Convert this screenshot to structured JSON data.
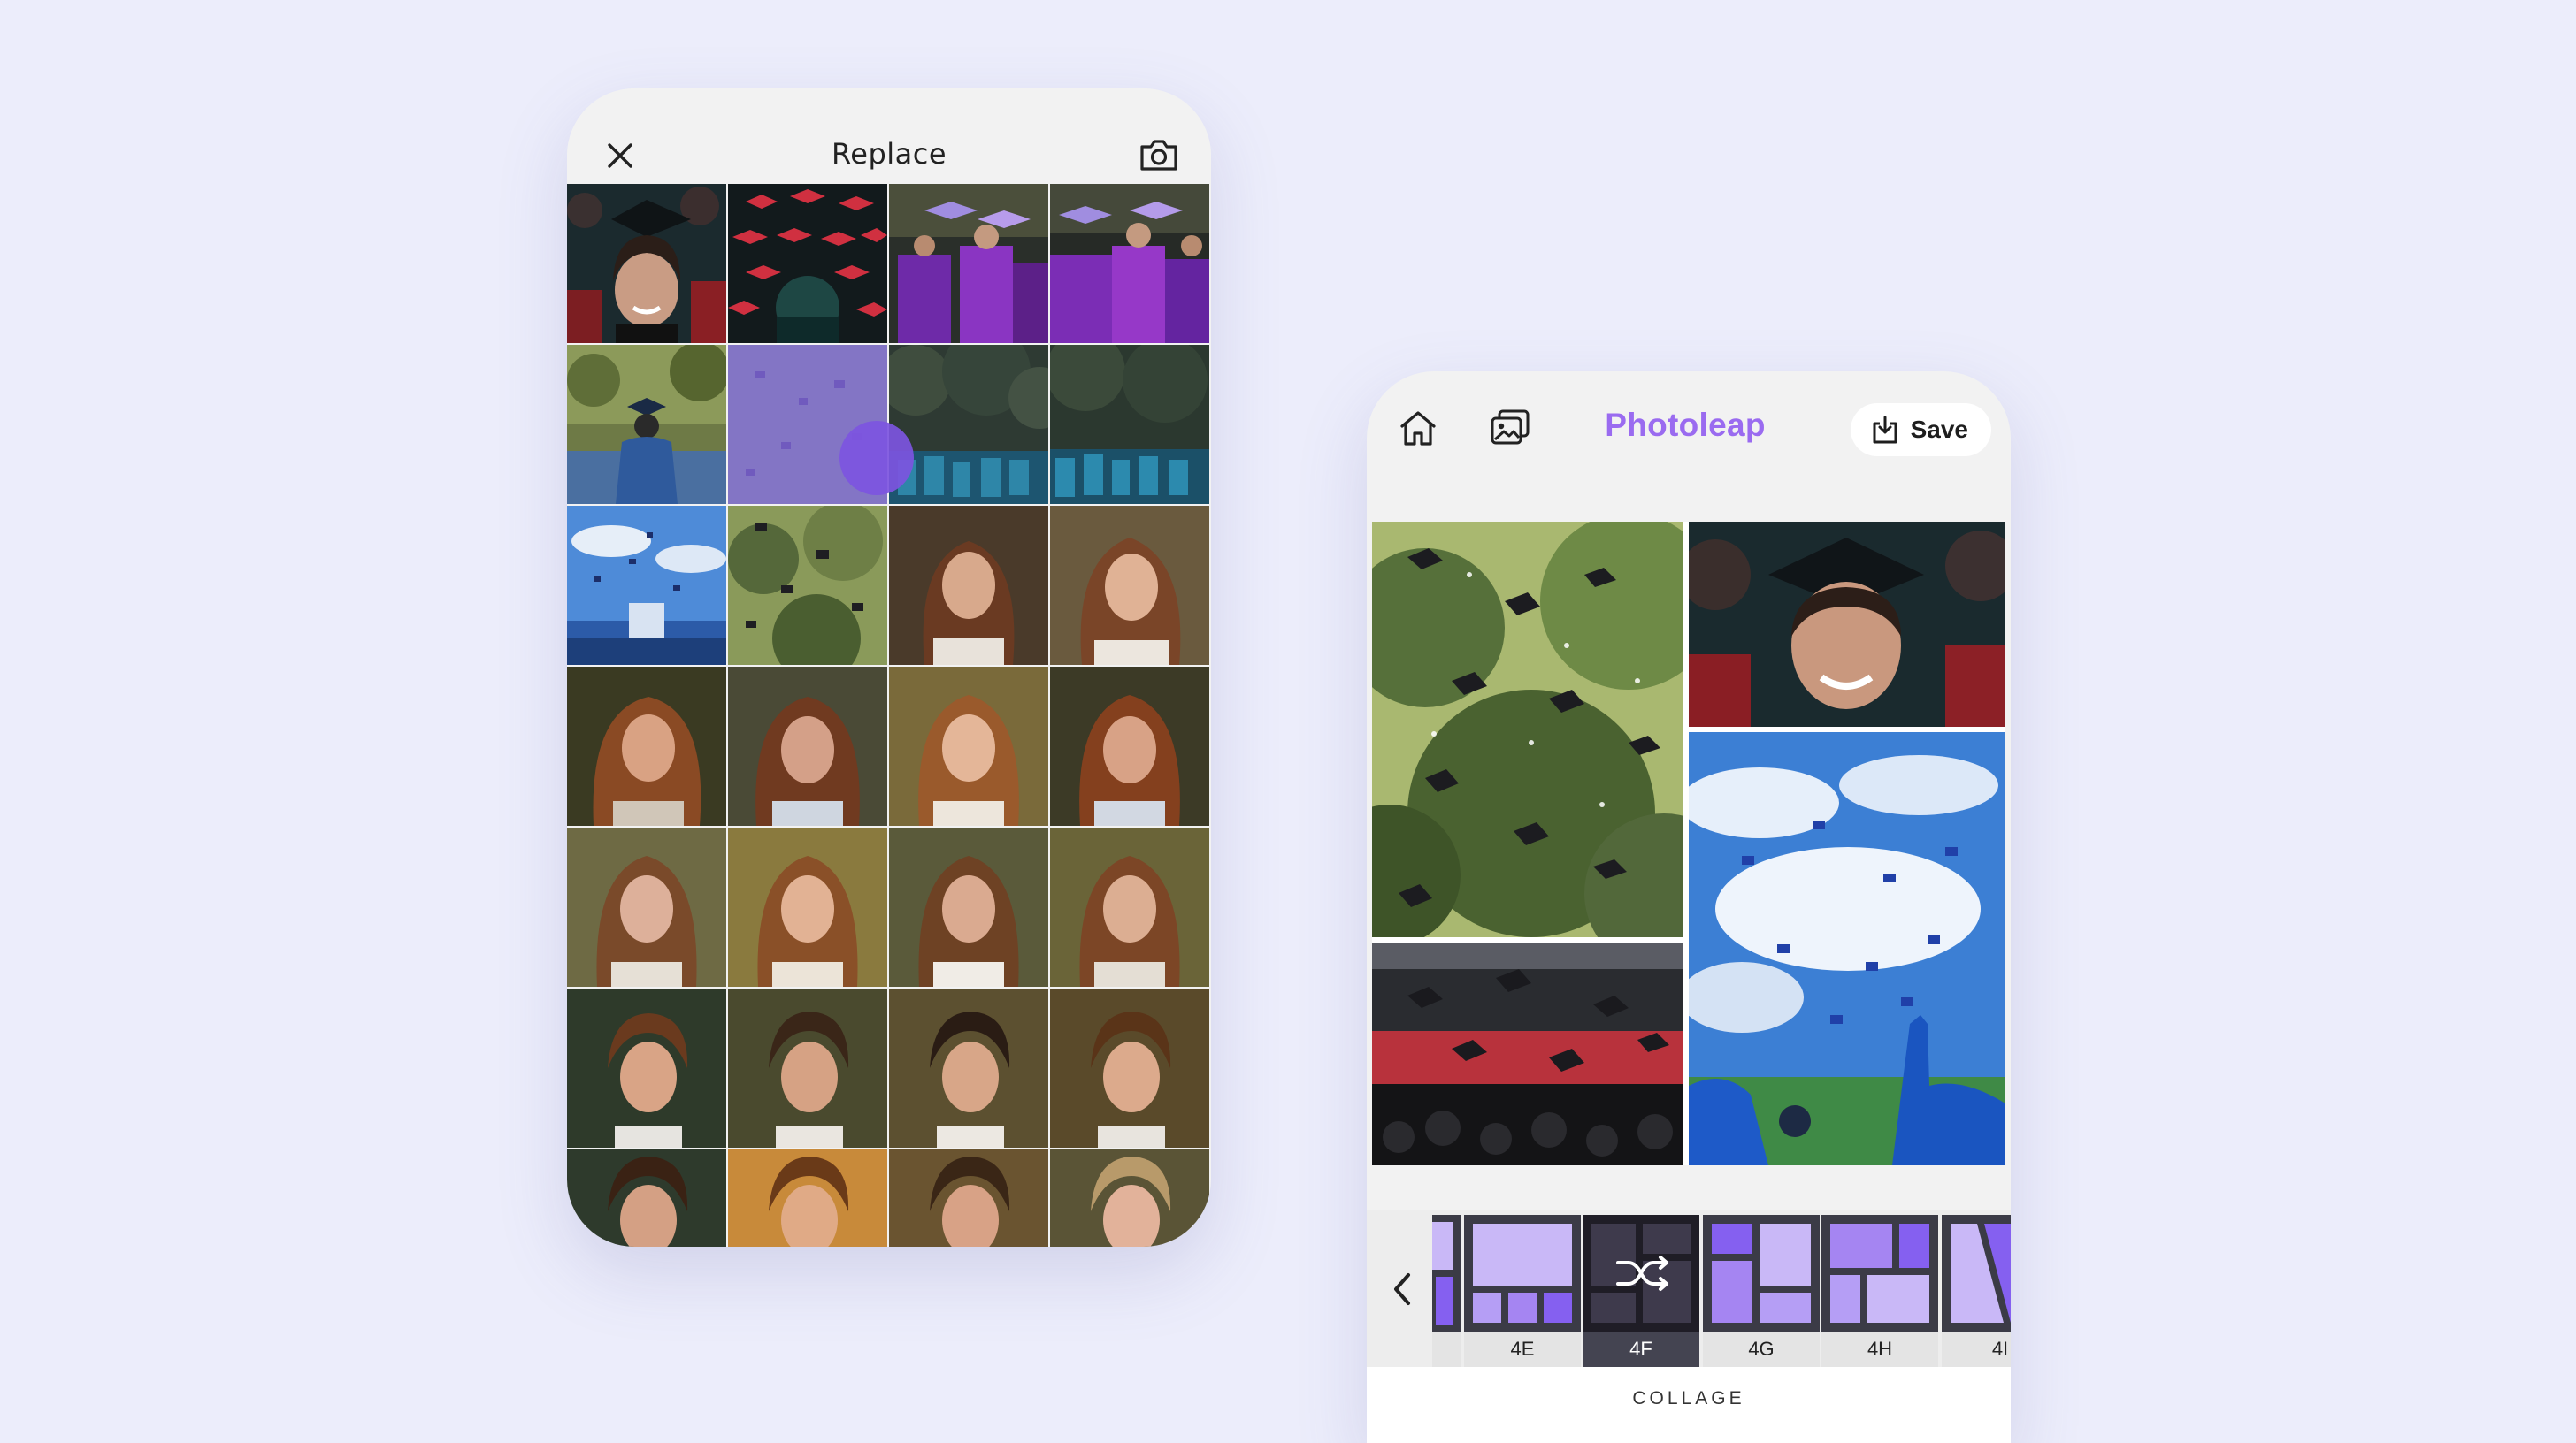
{
  "replace_screen": {
    "title": "Replace",
    "close_icon": "close-icon",
    "camera_icon": "camera-icon",
    "photos": [
      {
        "subject": "graduate-crowd-smiling"
      },
      {
        "subject": "red-caps-overhead"
      },
      {
        "subject": "purple-gowns-crowd"
      },
      {
        "subject": "purple-gowns-crowd-2"
      },
      {
        "subject": "graduate-blue-gown-back"
      },
      {
        "subject": "selected-purple-photo"
      },
      {
        "subject": "blue-gowns-trees"
      },
      {
        "subject": "blue-gowns-trees-2"
      },
      {
        "subject": "caps-thrown-blue-sky"
      },
      {
        "subject": "caps-in-trees"
      },
      {
        "subject": "woman-portrait-1"
      },
      {
        "subject": "woman-portrait-2"
      },
      {
        "subject": "woman-portrait-3"
      },
      {
        "subject": "woman-portrait-4"
      },
      {
        "subject": "woman-portrait-5"
      },
      {
        "subject": "woman-portrait-6"
      },
      {
        "subject": "woman-portrait-7"
      },
      {
        "subject": "woman-portrait-8"
      },
      {
        "subject": "woman-portrait-9"
      },
      {
        "subject": "woman-portrait-10"
      },
      {
        "subject": "man-portrait-1"
      },
      {
        "subject": "man-portrait-2"
      },
      {
        "subject": "man-portrait-3"
      },
      {
        "subject": "man-portrait-4"
      },
      {
        "subject": "man-portrait-5"
      },
      {
        "subject": "man-portrait-6"
      },
      {
        "subject": "man-portrait-7"
      },
      {
        "subject": "man-portrait-8"
      }
    ]
  },
  "editor": {
    "brand": "Photoleap",
    "save_label": "Save",
    "home_icon": "home-icon",
    "gallery_icon": "gallery-icon",
    "save_icon": "save-download-icon",
    "collage_cells": [
      "caps-in-trees",
      "graduate-smiling",
      "caps-thrown-auditorium",
      "caps-thrown-blue-sky"
    ],
    "layouts": [
      {
        "label": "",
        "active": false
      },
      {
        "label": "4E",
        "active": false
      },
      {
        "label": "4F",
        "active": true
      },
      {
        "label": "4G",
        "active": false
      },
      {
        "label": "4H",
        "active": false
      },
      {
        "label": "4I",
        "active": false
      }
    ],
    "shuffle_icon": "shuffle-icon",
    "back_icon": "chevron-left-icon",
    "section_label": "COLLAGE"
  },
  "colors": {
    "background": "#ECEDFB",
    "brand": "#9A6BF0",
    "layout_fill": "#C9B8F7",
    "layout_accent": "#8560F0"
  }
}
